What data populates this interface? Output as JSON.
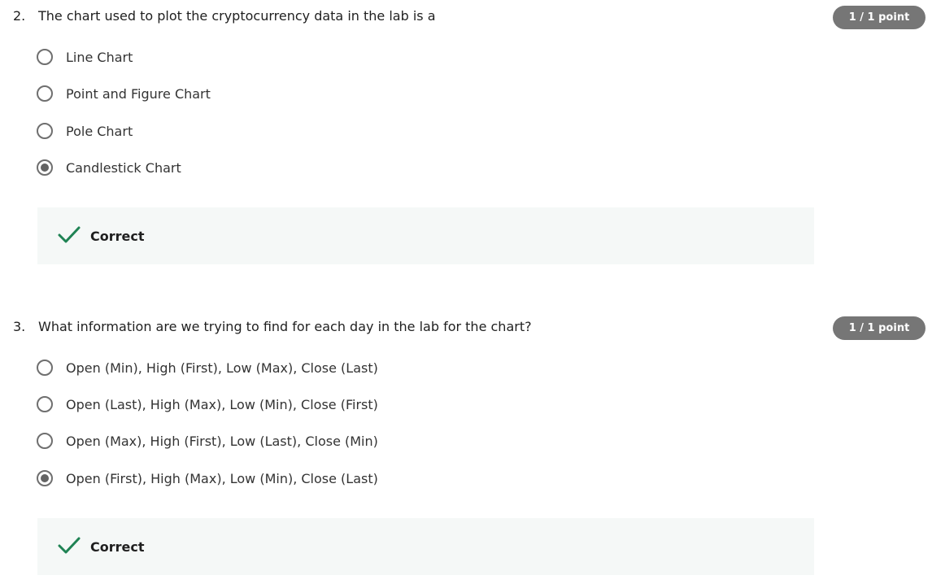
{
  "questions": [
    {
      "number": "2.",
      "text": "The chart used to plot the cryptocurrency data in the lab is a",
      "points": "1 / 1 point",
      "options": [
        {
          "label": "Line Chart",
          "selected": false
        },
        {
          "label": "Point and Figure Chart",
          "selected": false
        },
        {
          "label": "Pole Chart",
          "selected": false
        },
        {
          "label": "Candlestick Chart",
          "selected": true
        }
      ],
      "feedback": "Correct"
    },
    {
      "number": "3.",
      "text": "What information are we trying to find for each day in the lab for the chart?",
      "points": "1 / 1 point",
      "options": [
        {
          "label": "Open (Min), High (First), Low (Max), Close (Last)",
          "selected": false
        },
        {
          "label": "Open (Last), High (Max), Low (Min), Close (First)",
          "selected": false
        },
        {
          "label": "Open (Max), High (First), Low (Last), Close (Min)",
          "selected": false
        },
        {
          "label": "Open (First), High (Max), Low (Min), Close (Last)",
          "selected": true
        }
      ],
      "feedback": "Correct"
    }
  ],
  "colors": {
    "correct_green": "#1f8354",
    "badge_gray": "#767676",
    "feedback_bg": "#f5f8f7"
  },
  "icons": {
    "feedback": "checkmark-icon",
    "option": "radio-button"
  }
}
